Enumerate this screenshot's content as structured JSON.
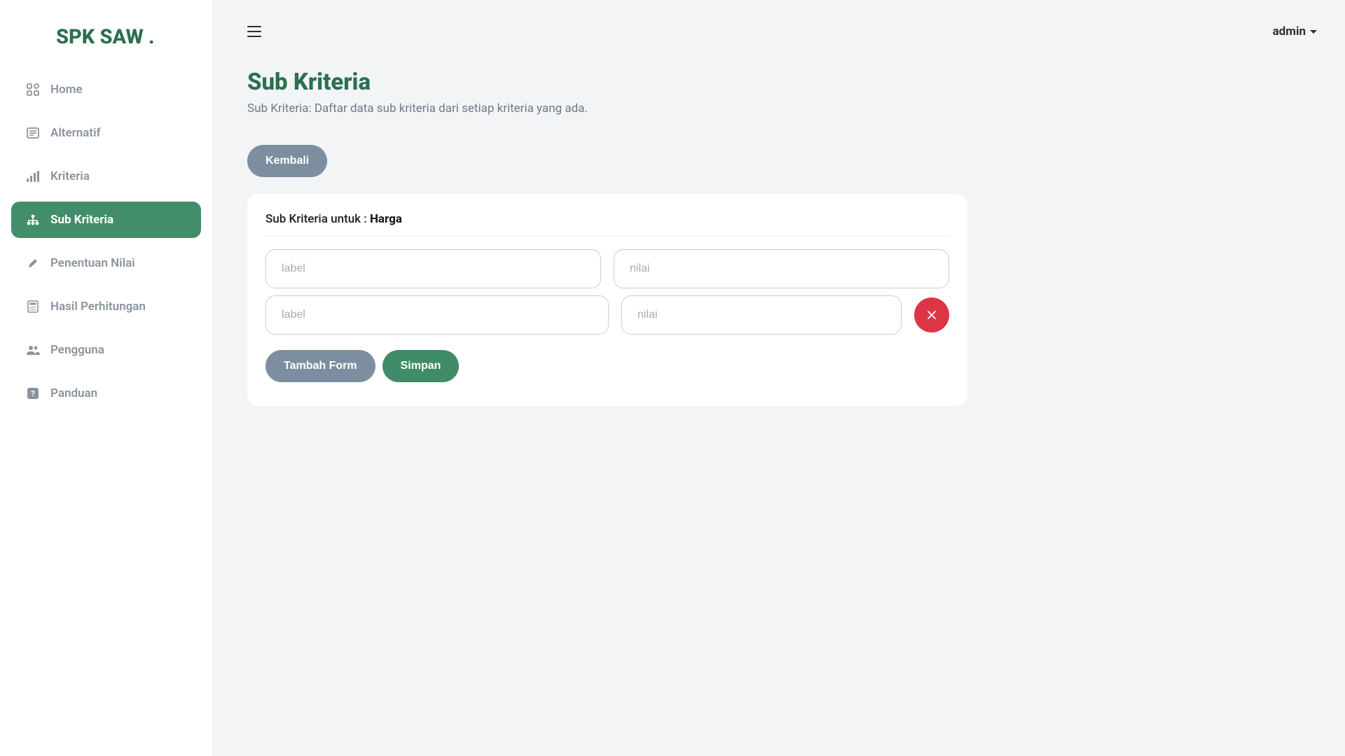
{
  "brand": "SPK SAW .",
  "user": {
    "name": "admin"
  },
  "sidebar": {
    "items": [
      {
        "label": "Home",
        "icon": "grid-icon",
        "active": false
      },
      {
        "label": "Alternatif",
        "icon": "alt-icon",
        "active": false
      },
      {
        "label": "Kriteria",
        "icon": "bars-icon",
        "active": false
      },
      {
        "label": "Sub Kriteria",
        "icon": "tree-icon",
        "active": true
      },
      {
        "label": "Penentuan Nilai",
        "icon": "pencil-icon",
        "active": false
      },
      {
        "label": "Hasil Perhitungan",
        "icon": "calc-icon",
        "active": false
      },
      {
        "label": "Pengguna",
        "icon": "users-icon",
        "active": false
      },
      {
        "label": "Panduan",
        "icon": "help-icon",
        "active": false
      }
    ]
  },
  "page": {
    "title": "Sub Kriteria",
    "subtitle": "Sub Kriteria: Daftar data sub kriteria dari setiap kriteria yang ada.",
    "back_label": "Kembali"
  },
  "form": {
    "title_prefix": "Sub Kriteria untuk : ",
    "kriteria_name": "Harga",
    "rows": [
      {
        "label_placeholder": "label",
        "nilai_placeholder": "nilai",
        "label_value": "",
        "nilai_value": "",
        "removable": false
      },
      {
        "label_placeholder": "label",
        "nilai_placeholder": "nilai",
        "label_value": "",
        "nilai_value": "",
        "removable": true
      }
    ],
    "add_label": "Tambah Form",
    "save_label": "Simpan"
  }
}
